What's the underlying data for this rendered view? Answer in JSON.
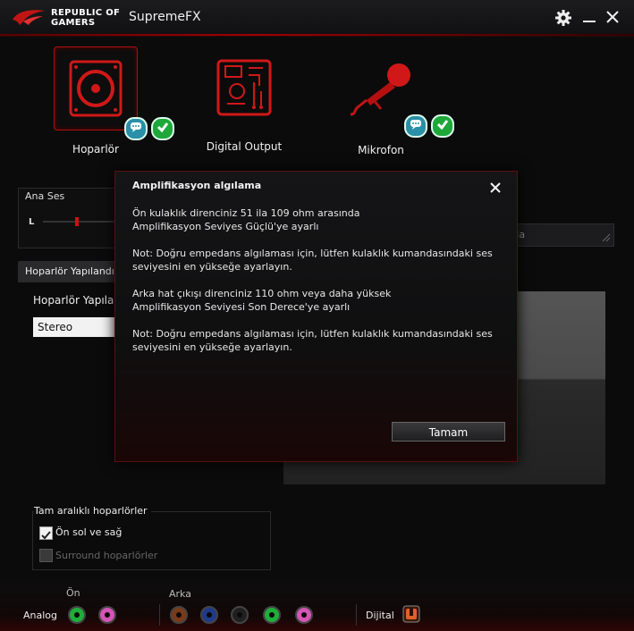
{
  "titlebar": {
    "brand_line1": "REPUBLIC OF",
    "brand_line2": "GAMERS",
    "app_title": "SupremeFX"
  },
  "devices": [
    {
      "label": "Hoparlör",
      "icon": "speaker-icon",
      "selected": true
    },
    {
      "label": "Digital Output",
      "icon": "digital-output-icon",
      "selected": false
    },
    {
      "label": "Mikrofon",
      "icon": "microphone-icon",
      "selected": false
    }
  ],
  "main_volume": {
    "label": "Ana Ses",
    "left_label": "L"
  },
  "speaker_config": {
    "tab_label": "Hoparlör Yapılandır",
    "field_label": "Hoparlör Yapılandı",
    "selected_value": "Stereo"
  },
  "right_field_text": "arla",
  "full_range": {
    "title": "Tam aralıklı hoparlörler",
    "front_label": "Ön sol ve sağ",
    "front_checked": true,
    "surround_label": "Surround hoparlörler",
    "surround_checked": false
  },
  "jacks": {
    "front_label": "Ön",
    "rear_label": "Arka",
    "analog_label": "Analog",
    "digital_label": "Dijital",
    "colors": {
      "green": "#1fae3a",
      "pink": "#d455b5",
      "brown": "#7a3a1a",
      "blue": "#1f3a8a",
      "black": "#202020",
      "digital": "#e0602a"
    }
  },
  "dialog": {
    "title": "Amplifikasyon algılama",
    "para1_line1": "Ön kulaklık direnciniz 51 ila 109 ohm arasında",
    "para1_line2": "Amplifikasyon Seviyes Güçlü'ye ayarlı",
    "para2_line1": "Not: Doğru empedans algılaması için, lütfen kulaklık kumandasındaki ses",
    "para2_line2": "seviyesini en yükseğe ayarlayın.",
    "para3_line1": "Arka hat çıkışı direnciniz 110 ohm veya daha yüksek",
    "para3_line2": "Amplifikasyon Seviyesi Son Derece'ye ayarlı",
    "para4_line1": "Not: Doğru empedans algılaması için, lütfen kulaklık kumandasındaki ses",
    "para4_line2": "seviyesini en yükseğe ayarlayın.",
    "ok_label": "Tamam"
  },
  "accent_color": "#c40f0f"
}
